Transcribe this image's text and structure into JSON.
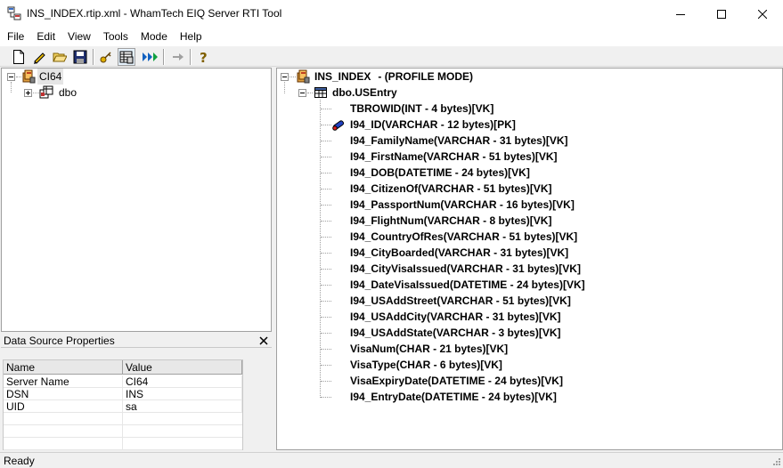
{
  "window": {
    "title": "INS_INDEX.rtip.xml - WhamTech EIQ Server RTI Tool",
    "app_icon": "rti-tool-icon"
  },
  "menu": [
    "File",
    "Edit",
    "View",
    "Tools",
    "Mode",
    "Help"
  ],
  "toolbar": {
    "buttons": [
      "new-icon",
      "edit-pencil-icon",
      "open-folder-icon",
      "save-icon",
      "key-icon",
      "grid-properties-icon",
      "run-all-icon",
      "arrow-right-icon",
      "help-icon"
    ]
  },
  "left_tree": {
    "root": "CI64",
    "children": [
      "dbo"
    ]
  },
  "data_source_panel": {
    "title": "Data Source Properties",
    "columns": [
      "Name",
      "Value"
    ],
    "rows": [
      {
        "name": "Server Name",
        "value": "CI64"
      },
      {
        "name": "DSN",
        "value": "INS"
      },
      {
        "name": "UID",
        "value": "sa"
      }
    ]
  },
  "right_tree": {
    "root_label": "INS_INDEX",
    "root_mode": "- (PROFILE MODE)",
    "table": "dbo.USEntry",
    "fields": [
      {
        "label": "TBROWID(INT - 4 bytes)[VK]",
        "icon": "blank"
      },
      {
        "label": "I94_ID(VARCHAR - 12 bytes)[PK]",
        "icon": "primary-key-icon"
      },
      {
        "label": "I94_FamilyName(VARCHAR - 31 bytes)[VK]",
        "icon": "blank"
      },
      {
        "label": "I94_FirstName(VARCHAR - 51 bytes)[VK]",
        "icon": "blank"
      },
      {
        "label": "I94_DOB(DATETIME - 24 bytes)[VK]",
        "icon": "blank"
      },
      {
        "label": "I94_CitizenOf(VARCHAR - 51 bytes)[VK]",
        "icon": "blank"
      },
      {
        "label": "I94_PassportNum(VARCHAR - 16 bytes)[VK]",
        "icon": "blank"
      },
      {
        "label": "I94_FlightNum(VARCHAR - 8 bytes)[VK]",
        "icon": "blank"
      },
      {
        "label": "I94_CountryOfRes(VARCHAR - 51 bytes)[VK]",
        "icon": "blank"
      },
      {
        "label": "I94_CityBoarded(VARCHAR - 31 bytes)[VK]",
        "icon": "blank"
      },
      {
        "label": "I94_CityVisaIssued(VARCHAR - 31 bytes)[VK]",
        "icon": "blank"
      },
      {
        "label": "I94_DateVisaIssued(DATETIME - 24 bytes)[VK]",
        "icon": "blank"
      },
      {
        "label": "I94_USAddStreet(VARCHAR - 51 bytes)[VK]",
        "icon": "blank"
      },
      {
        "label": "I94_USAddCity(VARCHAR - 31 bytes)[VK]",
        "icon": "blank"
      },
      {
        "label": "I94_USAddState(VARCHAR - 3 bytes)[VK]",
        "icon": "blank"
      },
      {
        "label": "VisaNum(CHAR - 21 bytes)[VK]",
        "icon": "blank"
      },
      {
        "label": "VisaType(CHAR - 6 bytes)[VK]",
        "icon": "blank"
      },
      {
        "label": "VisaExpiryDate(DATETIME - 24 bytes)[VK]",
        "icon": "blank"
      },
      {
        "label": "I94_EntryDate(DATETIME - 24 bytes)[VK]",
        "icon": "blank"
      }
    ]
  },
  "status": {
    "text": "Ready"
  }
}
